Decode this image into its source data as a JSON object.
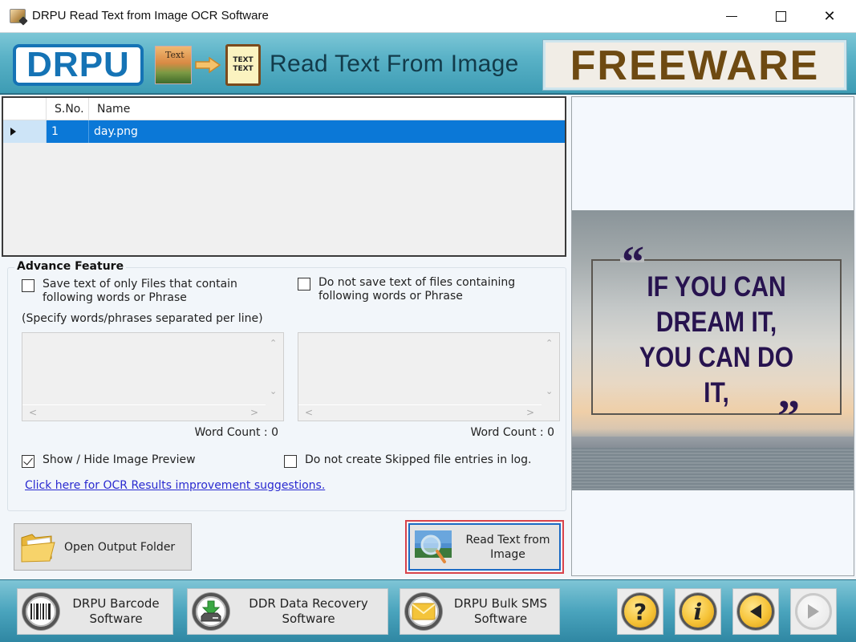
{
  "window": {
    "title": "DRPU Read Text from Image OCR Software",
    "controls": {
      "minimize": "minimize",
      "maximize": "maximize",
      "close": "✕"
    }
  },
  "banner": {
    "logo": "DRPU",
    "image_icon_text": "Text",
    "note_icon_line1": "TEXT",
    "note_icon_line2": "TEXT",
    "title": "Read Text From Image",
    "badge": "FREEWARE"
  },
  "file_grid": {
    "columns": [
      "S.No.",
      "Name"
    ],
    "rows": [
      {
        "sno": "1",
        "name": "day.png",
        "selected": true
      }
    ]
  },
  "advance_feature": {
    "legend": "Advance Feature",
    "include_option": {
      "label_line1": "Save text of only Files that contain",
      "label_line2": "following words or Phrase",
      "checked": false
    },
    "exclude_option": {
      "label_line1": "Do not save text of files containing",
      "label_line2": "following words or Phrase",
      "checked": false
    },
    "hint": "(Specify words/phrases separated per line)",
    "include_words": "",
    "exclude_words": "",
    "include_word_count": "Word Count : 0",
    "exclude_word_count": "Word Count : 0",
    "show_preview": {
      "label": "Show / Hide Image Preview",
      "checked": true
    },
    "skip_log": {
      "label": "Do not create Skipped file entries in log.",
      "checked": false
    },
    "link": "Click here for OCR Results improvement suggestions."
  },
  "actions": {
    "open_output": "Open Output Folder",
    "read_text_line1": "Read Text from",
    "read_text_line2": "Image"
  },
  "preview": {
    "quote_lines": [
      "IF YOU CAN",
      "DREAM IT,",
      "YOU CAN DO",
      "IT,"
    ],
    "open_quote": "“",
    "close_quote": "”"
  },
  "bottom_bar": {
    "products": [
      {
        "line1": "DRPU Barcode",
        "line2": "Software",
        "icon": "barcode-icon"
      },
      {
        "line1": "DDR Data Recovery",
        "line2": "Software",
        "icon": "drive-download-icon"
      },
      {
        "line1": "DRPU Bulk SMS",
        "line2": "Software",
        "icon": "envelope-icon"
      }
    ],
    "help": "?",
    "info": "i",
    "back": "back",
    "next": "next"
  },
  "colors": {
    "selection": "#0b78d7",
    "banner": "#4aa4bd",
    "logo_blue": "#1573b5",
    "freeware_text": "#6e4a12",
    "link": "#2a2ad0",
    "focus_outer": "#d9434b",
    "focus_inner": "#1c6bc4"
  }
}
